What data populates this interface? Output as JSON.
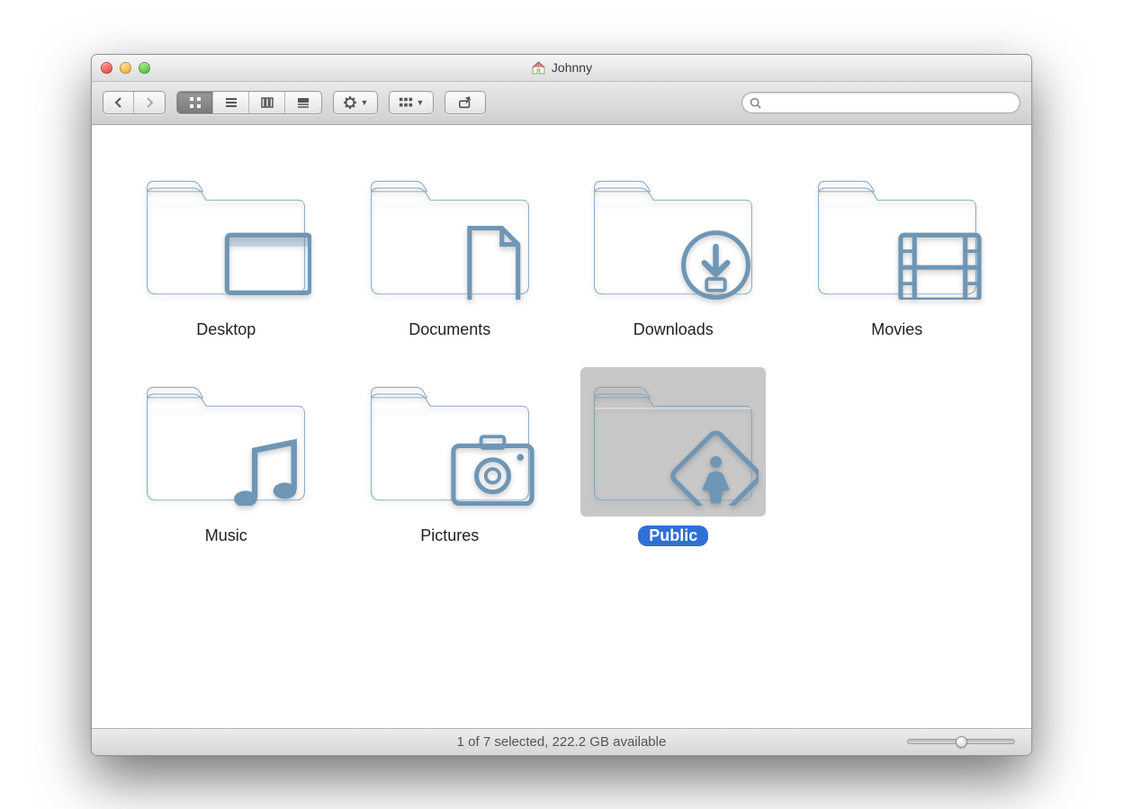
{
  "window": {
    "title": "Johnny",
    "home_icon": "home-icon"
  },
  "toolbar": {
    "back": "back",
    "forward": "forward",
    "views": {
      "icon": "icon-view",
      "list": "list-view",
      "column": "column-view",
      "coverflow": "coverflow-view",
      "active": "icon"
    },
    "action_menu": "action-menu",
    "arrange_menu": "arrange-menu",
    "share": "share",
    "search_placeholder": ""
  },
  "folders": [
    {
      "name": "Desktop",
      "glyph": "desktop",
      "selected": false
    },
    {
      "name": "Documents",
      "glyph": "documents",
      "selected": false
    },
    {
      "name": "Downloads",
      "glyph": "downloads",
      "selected": false
    },
    {
      "name": "Movies",
      "glyph": "movies",
      "selected": false
    },
    {
      "name": "Music",
      "glyph": "music",
      "selected": false
    },
    {
      "name": "Pictures",
      "glyph": "pictures",
      "selected": false
    },
    {
      "name": "Public",
      "glyph": "public",
      "selected": true
    }
  ],
  "status": {
    "text": "1 of 7 selected, 222.2 GB available"
  },
  "colors": {
    "folder_light": "#b9d2e5",
    "folder_dark": "#8eb4d2",
    "glyph": "#6f96b5",
    "selection_bg": "#c8c8c8",
    "selection_label": "#2f6fd6"
  }
}
